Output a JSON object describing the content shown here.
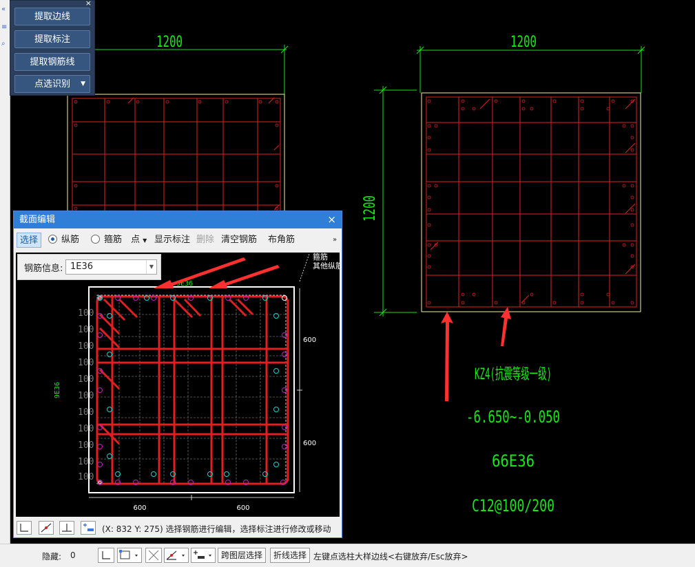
{
  "tool_panel": {
    "buttons": [
      "提取边线",
      "提取标注",
      "提取钢筋线",
      "点选识别"
    ]
  },
  "cad": {
    "left_dim_top": "1200",
    "right_dim_top": "1200",
    "right_dim_side": "1200",
    "column_name": "KZ4(抗震等级一级)",
    "column_elev": "-6.650~-0.050",
    "column_rebar": "66E36",
    "column_stirrup": "C12@100/200",
    "legend_lines": [
      "箍筋",
      "其他纵筋"
    ]
  },
  "dialog": {
    "title": "截面编辑",
    "toolbar": {
      "select": "选择",
      "longitudinal": "纵筋",
      "stirrup": "箍筋",
      "point": "点",
      "show_label": "显示标注",
      "delete": "删除",
      "clear_rebar": "清空钢筋",
      "corner_rebar": "布角筋"
    },
    "rebar_info_label": "钢筋信息:",
    "rebar_info_value": "1E36",
    "labels": {
      "top": "9E36",
      "left": "9E36",
      "right_upper": "600",
      "right_lower": "600",
      "bottom_left": "600",
      "bottom_right": "600",
      "spacing": "100"
    },
    "status_text": "(X: 832 Y: 275)  选择钢筋进行编辑，选择标注进行修改或移动"
  },
  "bottom_bar": {
    "hidden_label": "隐藏:",
    "hidden_count": "0",
    "cross_layer_select": "跨图层选择",
    "polyline_select": "折线选择",
    "prompt": "左键点选柱大样边线<右键放弃/Esc放弃>"
  },
  "colors": {
    "cad_green": "#19e619",
    "rebar_red": "#e02020",
    "outline_yellow": "#f2f0a0",
    "arrow_red": "#ff3030",
    "title_blue": "#2f7fd8",
    "panel_navy": "#2b3f5c"
  }
}
